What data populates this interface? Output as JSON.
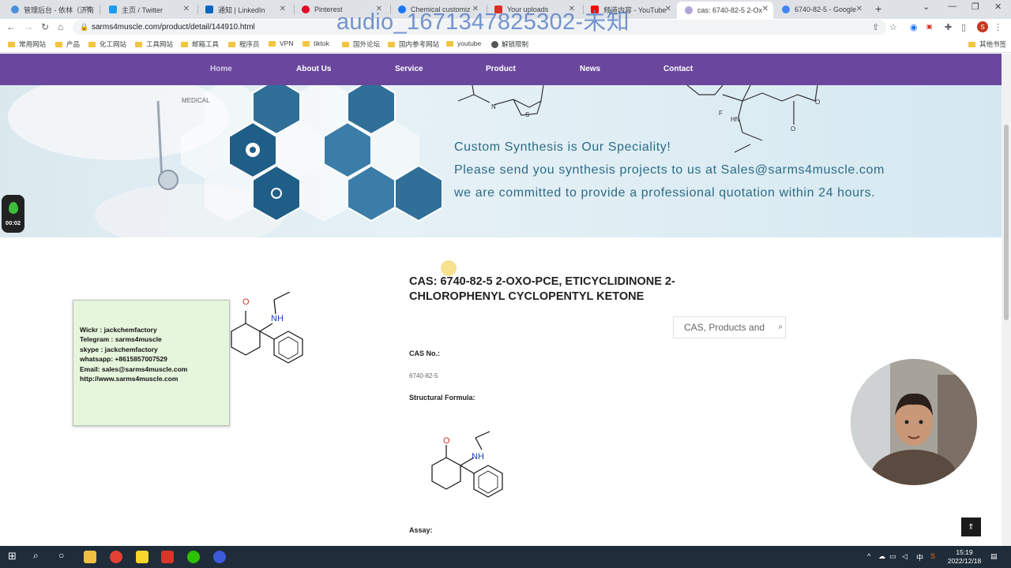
{
  "browser": {
    "tabs": [
      {
        "title": "管理后台 - 依林（济南",
        "color": "#4a90d9"
      },
      {
        "title": "主页 / Twitter",
        "color": "#1d9bf0"
      },
      {
        "title": "通知 | LinkedIn",
        "color": "#0a66c2"
      },
      {
        "title": "Pinterest",
        "color": "#e60023"
      },
      {
        "title": "Chemical customiz",
        "color": "#1877f2"
      },
      {
        "title": "Your uploads",
        "color": "#d93025"
      },
      {
        "title": "频道内容 - YouTube",
        "color": "#ff0000"
      },
      {
        "title": "cas: 6740-82-5 2-Ox",
        "color": "#b0a5d4"
      },
      {
        "title": "6740-82-5 - Google",
        "color": "#4285f4"
      }
    ],
    "new_tab": "+",
    "url": "sarms4muscle.com/product/detail/144910.html",
    "profile_initial": "S",
    "bookmarks": [
      "常用网站",
      "产品",
      "化工网站",
      "工具网站",
      "邮箱工具",
      "程序员",
      "VPN",
      "tiktok",
      "国外论坛",
      "国内参考网站",
      "youtube",
      "解锁限制",
      "其他书签"
    ]
  },
  "watermark": "audio_1671347825302-未知",
  "site_nav": {
    "items": [
      "Home",
      "About Us",
      "Service",
      "Product",
      "News",
      "Contact"
    ]
  },
  "banner": {
    "line1": "Custom Synthesis is Our Speciality!",
    "line2": "Please send you synthesis projects to us at Sales@sarms4muscle.com",
    "line3": "we are committed to provide a professional quotation within 24 hours.",
    "hex_medical": "MEDICAL"
  },
  "product": {
    "title": "CAS: 6740-82-5 2-OXO-PCE, ETICYCLIDINONE 2-CHLOROPHENYL CYCLOPENTYL KETONE",
    "search_placeholder": "CAS, Products and",
    "cas_label": "CAS No.:",
    "cas_value": "6740-82-5",
    "formula_label": "Structural Formula:",
    "assay_label": "Assay:",
    "molecule": {
      "o": "O",
      "nh": "NH"
    }
  },
  "contact_card": {
    "lines": [
      "Wickr : jackchemfactory",
      "Telegram :  sarms4muscle",
      "skype :  jackchemfactory",
      "whatsapp: +8615857007529",
      "Email: sales@sarms4muscle.com",
      "http://www.sarms4muscle.com"
    ]
  },
  "recorder": {
    "time": "00:02"
  },
  "taskbar": {
    "time": "15:19",
    "date": "2022/12/18",
    "ime": "中"
  }
}
